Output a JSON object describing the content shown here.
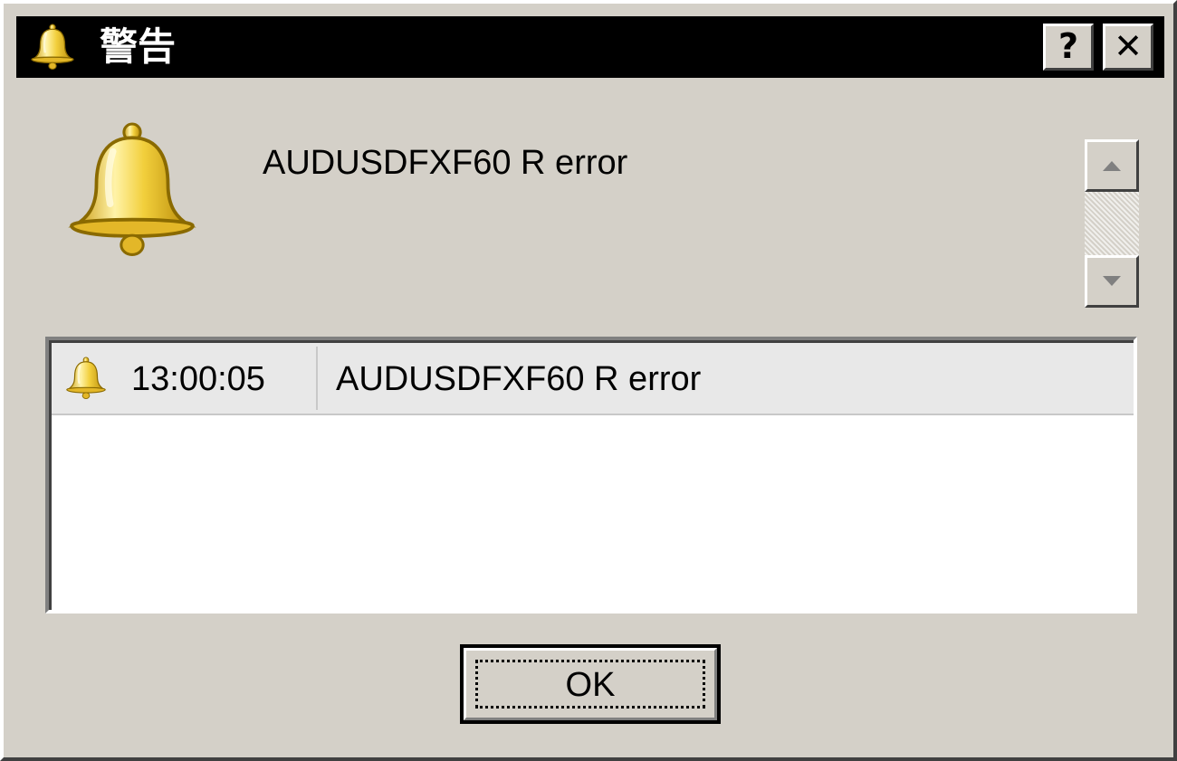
{
  "window": {
    "title": "警告",
    "help_label": "?",
    "close_label": "✕"
  },
  "icons": {
    "title": "bell-icon",
    "main": "bell-icon",
    "row": "bell-icon",
    "scroll_up": "arrow-up-icon",
    "scroll_down": "arrow-down-icon"
  },
  "message": "AUDUSDFXF60 R error",
  "alerts": [
    {
      "time": "13:00:05",
      "message": "AUDUSDFXF60 R error"
    }
  ],
  "buttons": {
    "ok_label": "OK"
  },
  "colors": {
    "bell": "#e8c230",
    "dialog_bg": "#d4d0c8",
    "titlebar_bg": "#000000"
  }
}
